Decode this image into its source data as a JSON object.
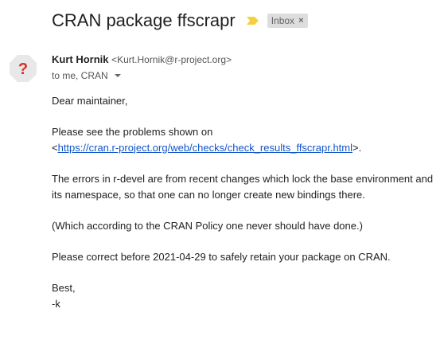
{
  "subject": "CRAN package ffscrapr",
  "label_chip": {
    "label": "Inbox",
    "remove": "×"
  },
  "avatar": {
    "glyph": "?",
    "bg": "#e8e8e8",
    "fg": "#d93025"
  },
  "sender": {
    "name": "Kurt Hornik",
    "email": "<Kurt.Hornik@r-project.org>"
  },
  "recipients": "to me, CRAN",
  "message": {
    "greeting": "Dear maintainer,",
    "p1_line1": "Please see the problems shown on",
    "p1_prefix": "<",
    "p1_link": "https://cran.r-project.org/web/checks/check_results_ffscrapr.html",
    "p1_suffix": ">.",
    "p2": "The errors in r-devel are from recent changes which lock the base environment and its namespace, so that one can no longer create new bindings there.",
    "p3": "(Which according to the CRAN Policy one never should have done.)",
    "p4": "Please correct before 2021-04-29 to safely retain your package on CRAN.",
    "signoff": "Best,",
    "signature": "-k"
  },
  "colors": {
    "importance_marker": "#f4d03f",
    "link": "#1155cc",
    "chip_bg": "#dddddd"
  }
}
